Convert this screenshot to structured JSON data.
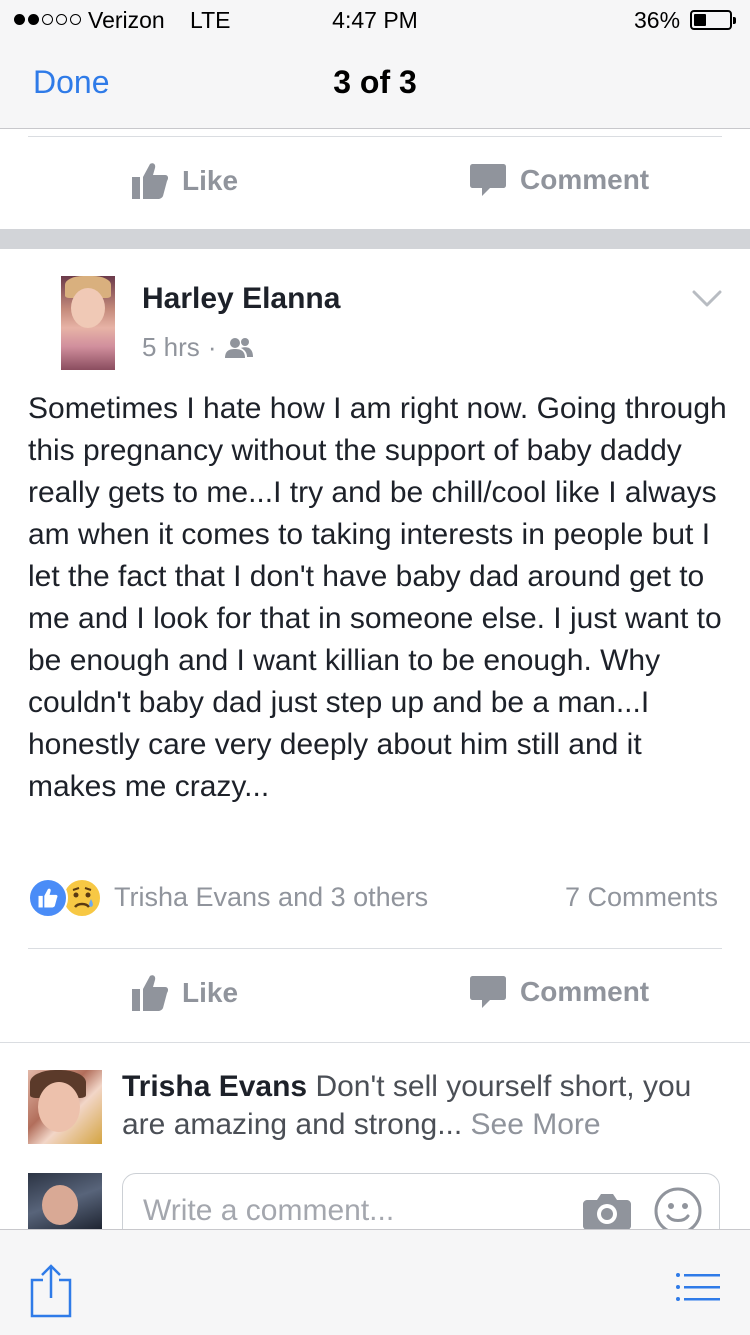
{
  "status_bar": {
    "carrier": "Verizon",
    "network": "LTE",
    "time": "4:47 PM",
    "battery": "36%",
    "battery_level": 0.36,
    "signal_bars_filled": 2,
    "signal_bars_total": 5
  },
  "nav": {
    "done_label": "Done",
    "page_indicator": "3 of 3"
  },
  "prev_post_actions": {
    "like_label": "Like",
    "comment_label": "Comment"
  },
  "post": {
    "author": "Harley Elanna",
    "time": "5 hrs",
    "separator": "·",
    "audience_icon": "friends-icon",
    "text": "Sometimes I hate how I am right now. Going through this pregnancy without the support of baby daddy really gets to me...I try and be chill/cool like I always am when it comes to taking interests in people but I let the fact that I don't have baby dad around get to me and I look for that in someone else. I just want to be enough and I want killian to be enough. Why couldn't baby dad just step up and be a man...I honestly care very deeply about him still and it makes me crazy...",
    "reactions_text": "Trisha Evans and 3 others",
    "comments_count": "7 Comments",
    "like_label": "Like",
    "comment_label": "Comment"
  },
  "comment": {
    "author": "Trisha Evans",
    "text": "Don't sell yourself short, you are amazing and strong...",
    "see_more": "See More"
  },
  "composer": {
    "placeholder": "Write a comment..."
  },
  "colors": {
    "accent": "#2f7be8",
    "gray_text": "#90949c",
    "like_reaction": "#4a8cf7",
    "sad_reaction": "#f7c844"
  }
}
